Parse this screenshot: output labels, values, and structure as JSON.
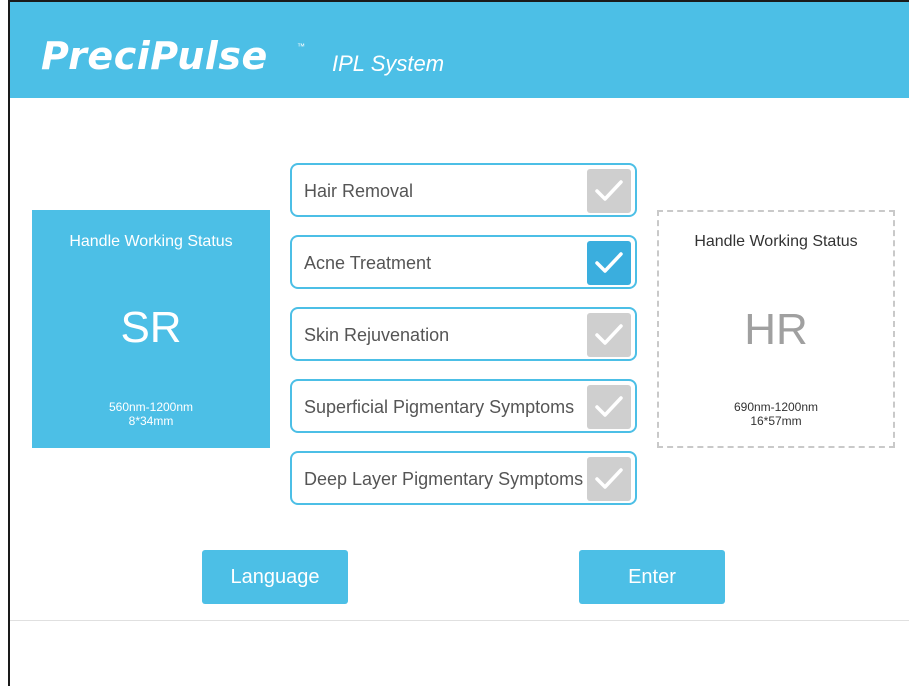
{
  "header": {
    "logo_text": "PreciPulse",
    "trademark": "™",
    "subtitle": "IPL System",
    "color": "#4cbfe6"
  },
  "handles": [
    {
      "title": "Handle Working Status",
      "code": "SR",
      "range": "560nm-1200nm",
      "size": "8*34mm",
      "active": true
    },
    {
      "title": "Handle Working Status",
      "code": "HR",
      "range": "690nm-1200nm",
      "size": "16*57mm",
      "active": false
    }
  ],
  "treatments": [
    {
      "label": "Hair Removal",
      "checked": false
    },
    {
      "label": "Acne Treatment",
      "checked": true
    },
    {
      "label": "Skin Rejuvenation",
      "checked": false
    },
    {
      "label": "Superficial Pigmentary Symptoms",
      "checked": false
    },
    {
      "label": "Deep Layer Pigmentary Symptoms",
      "checked": false
    }
  ],
  "buttons": {
    "language": "Language",
    "enter": "Enter"
  },
  "icons": {
    "check": "checkmark-icon"
  }
}
